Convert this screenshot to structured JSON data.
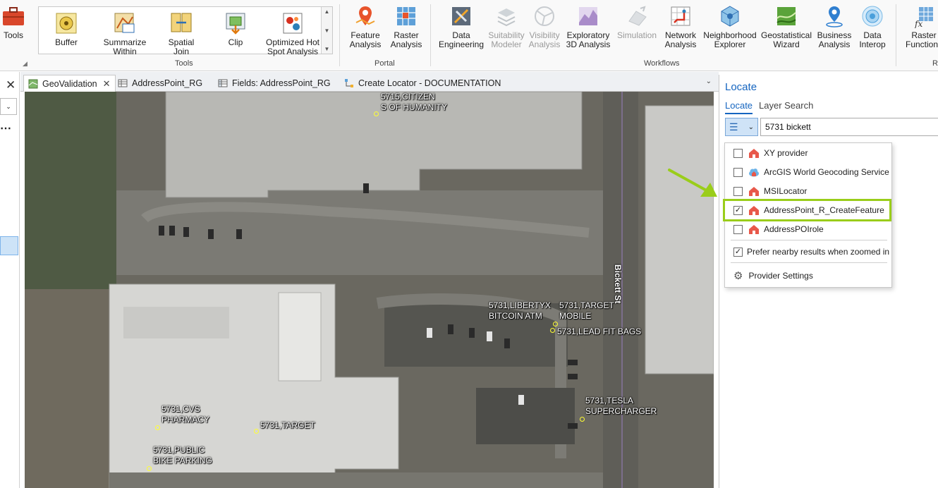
{
  "ribbon": {
    "tools_label": "Tools",
    "gallery": {
      "items": [
        {
          "label": "Buffer",
          "icon": "buffer-icon"
        },
        {
          "label": "Summarize Within",
          "icon": "summarize-within-icon"
        },
        {
          "label": "Spatial Join",
          "icon": "spatial-join-icon"
        },
        {
          "label": "Clip",
          "icon": "clip-icon"
        },
        {
          "label": "Optimized Hot Spot Analysis",
          "icon": "hot-spot-icon"
        }
      ],
      "group_label": "Tools"
    },
    "portal": {
      "items": [
        {
          "label": "Feature Analysis",
          "icon": "feature-analysis-icon"
        },
        {
          "label": "Raster Analysis",
          "icon": "raster-analysis-icon"
        }
      ],
      "group_label": "Portal"
    },
    "workflows": {
      "items": [
        {
          "label": "Data Engineering",
          "icon": "data-engineering-icon"
        },
        {
          "label": "Suitability Modeler",
          "icon": "suitability-modeler-icon"
        },
        {
          "label": "Visibility Analysis",
          "icon": "visibility-analysis-icon"
        },
        {
          "label": "Exploratory 3D Analysis",
          "icon": "exploratory-3d-icon"
        },
        {
          "label": "Simulation",
          "icon": "simulation-icon"
        },
        {
          "label": "Network Analysis",
          "icon": "network-analysis-icon"
        },
        {
          "label": "Neighborhood Explorer",
          "icon": "neighborhood-explorer-icon"
        },
        {
          "label": "Geostatistical Wizard",
          "icon": "geostatistical-wizard-icon"
        },
        {
          "label": "Business Analysis",
          "icon": "business-analysis-icon"
        },
        {
          "label": "Data Interop",
          "icon": "data-interop-icon"
        },
        {
          "label": "Raster Functions",
          "icon": "raster-functions-icon"
        }
      ],
      "group_label": "Workflows",
      "cut_group_label": "R"
    }
  },
  "tabs": [
    {
      "label": "GeoValidation",
      "icon": "map-icon"
    },
    {
      "label": "AddressPoint_RG",
      "icon": "table-icon"
    },
    {
      "label": "Fields: AddressPoint_RG",
      "icon": "fields-icon"
    },
    {
      "label": "Create Locator - DOCUMENTATION",
      "icon": "model-icon"
    }
  ],
  "map": {
    "street_label": "Bickett St",
    "labels": [
      "5715,CITIZEN\nS OF HUMANITY",
      "5731,LIBERTYX\nBITCOIN ATM",
      "5731,TARGET\nMOBILE",
      "5731,LEAD FIT BAGS",
      "5731,TESLA\nSUPERCHARGER",
      "5731,CVS\nPHARMACY",
      "5731,TARGET",
      "5731,PUBLIC\nBIKE PARKING"
    ]
  },
  "locate": {
    "title": "Locate",
    "tabs": [
      "Locate",
      "Layer Search"
    ],
    "search_value": "5731 bickett",
    "providers": [
      {
        "label": "XY provider",
        "checked": false,
        "icon": "locator-icon"
      },
      {
        "label": "ArcGIS World Geocoding Service",
        "checked": false,
        "icon": "cloud-locator-icon"
      },
      {
        "label": "MSILocator",
        "checked": false,
        "icon": "locator-icon"
      },
      {
        "label": "AddressPoint_R_CreateFeature",
        "checked": true,
        "icon": "locator-icon"
      },
      {
        "label": "AddressPOIrole",
        "checked": false,
        "icon": "locator-icon"
      }
    ],
    "prefer_nearby": {
      "label": "Prefer nearby results when zoomed in",
      "checked": true
    },
    "provider_settings": "Provider Settings",
    "highlight_color": "#9acd1a"
  }
}
